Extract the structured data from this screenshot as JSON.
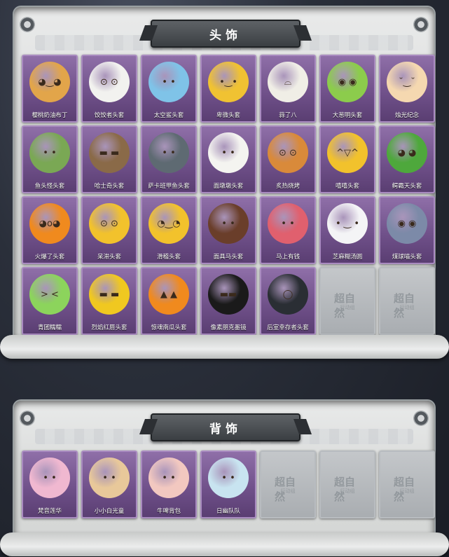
{
  "sections": [
    {
      "title": "头饰",
      "items": [
        {
          "label": "樱桃奶油布丁",
          "color": "#e2a54a",
          "face": "◕‿◕"
        },
        {
          "label": "饺饺者头套",
          "color": "#f2f2ef",
          "face": "⊙ ⊙"
        },
        {
          "label": "太空鲨头套",
          "color": "#7fc3e8",
          "face": "• •"
        },
        {
          "label": "卑微头套",
          "color": "#f0c232",
          "face": "•‿•"
        },
        {
          "label": "蒜了八",
          "color": "#f0eee6",
          "face": "⌓"
        },
        {
          "label": "大葱明头套",
          "color": "#8ccc4c",
          "face": "◉ ◉"
        },
        {
          "label": "烛光纪念",
          "color": "#f5d8b0",
          "face": "˘‿˘"
        },
        {
          "label": "鱼头怪头套",
          "color": "#7aa854",
          "face": "• •"
        },
        {
          "label": "哈士奇头套",
          "color": "#8a6a48",
          "face": "▬ ▬"
        },
        {
          "label": "萨卡班甲鱼头套",
          "color": "#5e6a72",
          "face": "• •"
        },
        {
          "label": "面墩墩头套",
          "color": "#f4f4f0",
          "face": "• •"
        },
        {
          "label": "炙热烧烤",
          "color": "#d98a3a",
          "face": "⊙ ⊙"
        },
        {
          "label": "嘻嘻头套",
          "color": "#f2c22c",
          "face": "^▽^"
        },
        {
          "label": "鳄霸天头套",
          "color": "#4ea83c",
          "face": "◕ ◕"
        },
        {
          "label": "火爆了头套",
          "color": "#f08a1e",
          "face": "◕o◕"
        },
        {
          "label": "呆滞头套",
          "color": "#f2c22c",
          "face": "⊙ ⊙"
        },
        {
          "label": "滑稽头套",
          "color": "#f2c22c",
          "face": "◔‿◔"
        },
        {
          "label": "面具马头套",
          "color": "#6a3e2a",
          "face": "• •"
        },
        {
          "label": "马上有钱",
          "color": "#e0606e",
          "face": "• •"
        },
        {
          "label": "芝麻糊汤圆",
          "color": "#f4f4f6",
          "face": "• ‿ •"
        },
        {
          "label": "煤球喵头套",
          "color": "#7c8aa8",
          "face": "◉ ◉"
        },
        {
          "label": "青团糯糯",
          "color": "#8cd45c",
          "face": "> <"
        },
        {
          "label": "烈焰红唇头套",
          "color": "#f0c820",
          "face": "▬ ▬"
        },
        {
          "label": "惊魂南瓜头套",
          "color": "#f08a1e",
          "face": "▲ ▲"
        },
        {
          "label": "像素朋克墨镜",
          "color": "#1a1a1a",
          "face": "▬▬"
        },
        {
          "label": "后室幸存者头套",
          "color": "#2a2e34",
          "face": "◯"
        },
        {
          "label": "",
          "empty": true
        },
        {
          "label": "",
          "empty": true
        }
      ]
    },
    {
      "title": "背饰",
      "items": [
        {
          "label": "梵音莲华",
          "color": "#f0b8d0",
          "face": "• •"
        },
        {
          "label": "小小白光童",
          "color": "#e8c89a",
          "face": "• •"
        },
        {
          "label": "牛啤背包",
          "color": "#f2c8c0",
          "face": "• •"
        },
        {
          "label": "日幽队队",
          "color": "#c8e4f0",
          "face": "• •"
        },
        {
          "label": "",
          "empty": true
        },
        {
          "label": "",
          "empty": true
        },
        {
          "label": "",
          "empty": true
        }
      ]
    }
  ],
  "watermark": {
    "main": "超自然",
    "sub": "行动组"
  }
}
